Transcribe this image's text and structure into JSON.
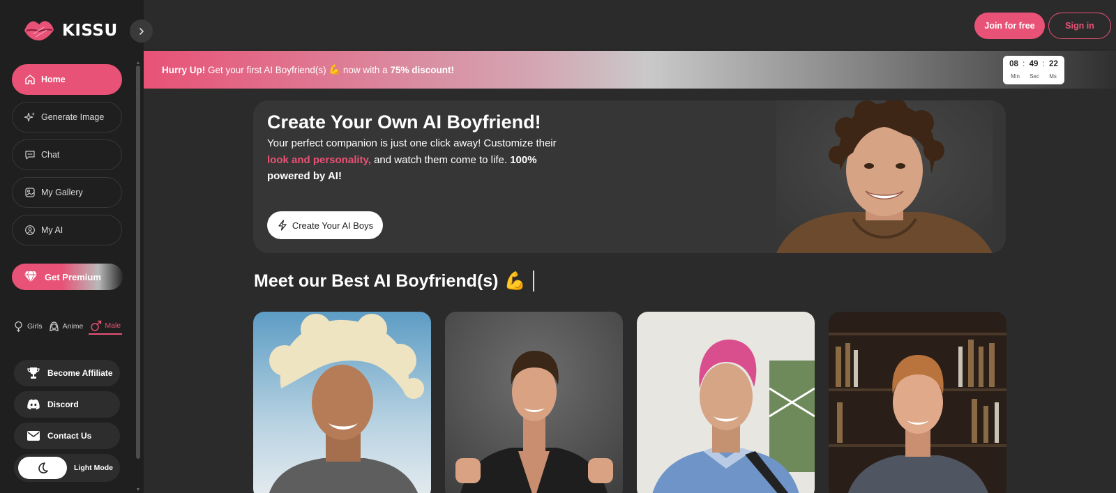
{
  "brand": {
    "name": "KISSU"
  },
  "sidebar": {
    "nav": [
      {
        "label": "Home",
        "icon": "home-icon",
        "active": true
      },
      {
        "label": "Generate Image",
        "icon": "sparkle-icon",
        "active": false
      },
      {
        "label": "Chat",
        "icon": "chat-icon",
        "active": false
      },
      {
        "label": "My Gallery",
        "icon": "gallery-icon",
        "active": false
      },
      {
        "label": "My AI",
        "icon": "user-badge-icon",
        "active": false
      }
    ],
    "premium_label": "Get Premium",
    "categories": [
      {
        "label": "Girls",
        "icon": "female-icon",
        "active": false
      },
      {
        "label": "Anime",
        "icon": "anime-icon",
        "active": false
      },
      {
        "label": "Male",
        "icon": "male-icon",
        "active": true
      }
    ],
    "extras": [
      {
        "label": "Become Affiliate",
        "icon": "trophy-icon"
      },
      {
        "label": "Discord",
        "icon": "discord-icon"
      },
      {
        "label": "Contact Us",
        "icon": "mail-icon"
      }
    ],
    "theme_label": "Light Mode"
  },
  "header": {
    "join_label": "Join for free",
    "signin_label": "Sign in"
  },
  "promo": {
    "hurry": "Hurry Up!",
    "text_before": " Get your first AI Boyfriend(s) ",
    "emoji": "💪",
    "text_middle": " now with a ",
    "discount": "75% discount!",
    "timer": {
      "min": "08",
      "sec": "49",
      "ms": "22",
      "min_label": "Min",
      "sec_label": "Sec",
      "ms_label": "Ms"
    }
  },
  "hero": {
    "title": "Create Your Own AI Boyfriend!",
    "text_1": "Your perfect companion is just one click away! Customize their ",
    "highlight": "look and personality,",
    "text_2": " and watch them come to life. ",
    "bold_end": "100% powered by AI!",
    "button_label": "Create Your AI Boys"
  },
  "section": {
    "title": "Meet our Best AI Boyfriend(s)",
    "emoji": "💪"
  },
  "colors": {
    "accent": "#e85276",
    "sidebar_bg": "#1f1f1f",
    "main_bg": "#2b2b2b",
    "card_bg": "#363636"
  }
}
